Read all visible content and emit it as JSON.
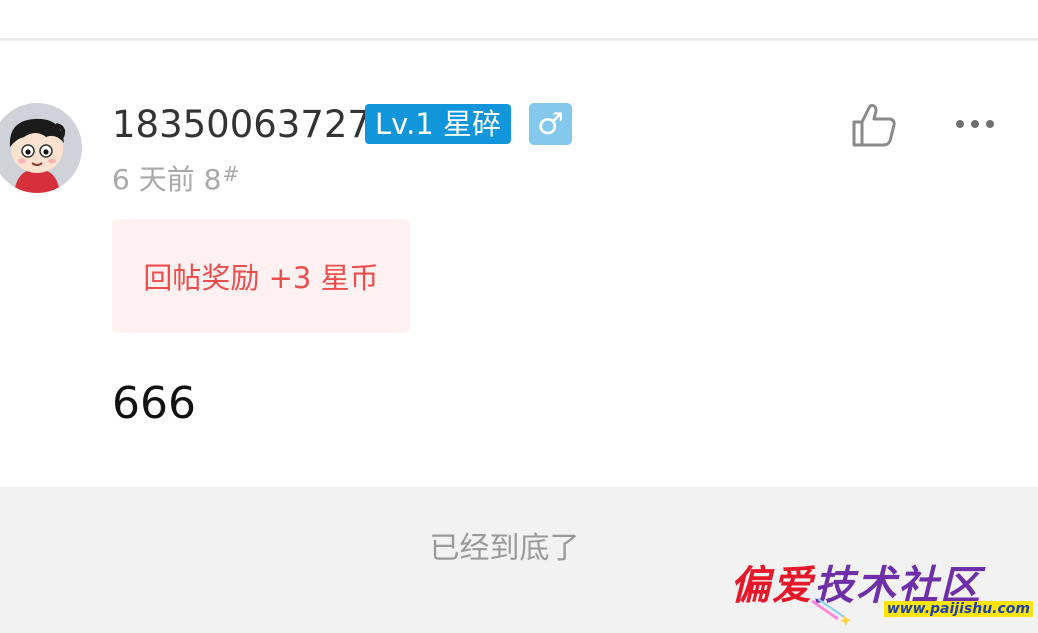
{
  "post": {
    "username": "18350063727",
    "level": "Lv.1 星碎",
    "gender_symbol": "♂",
    "time": "6 天前",
    "floor": "8",
    "floor_mark": "#",
    "reward": "回帖奖励 +3 星币",
    "content": "666"
  },
  "icons": {
    "like": "thumbs-up-icon",
    "more": "more-dots-icon",
    "gender": "male-icon"
  },
  "footer": {
    "end_text": "已经到底了"
  },
  "watermark": {
    "title_a": "偏爱",
    "title_b": "技术社区",
    "url": "www.paijishu.com"
  },
  "colors": {
    "level_badge": "#1296db",
    "gender_badge": "#84c8ee",
    "reward_bg": "#fff1f1",
    "reward_text": "#ee4d4d",
    "footer_bg": "#f2f2f2"
  }
}
